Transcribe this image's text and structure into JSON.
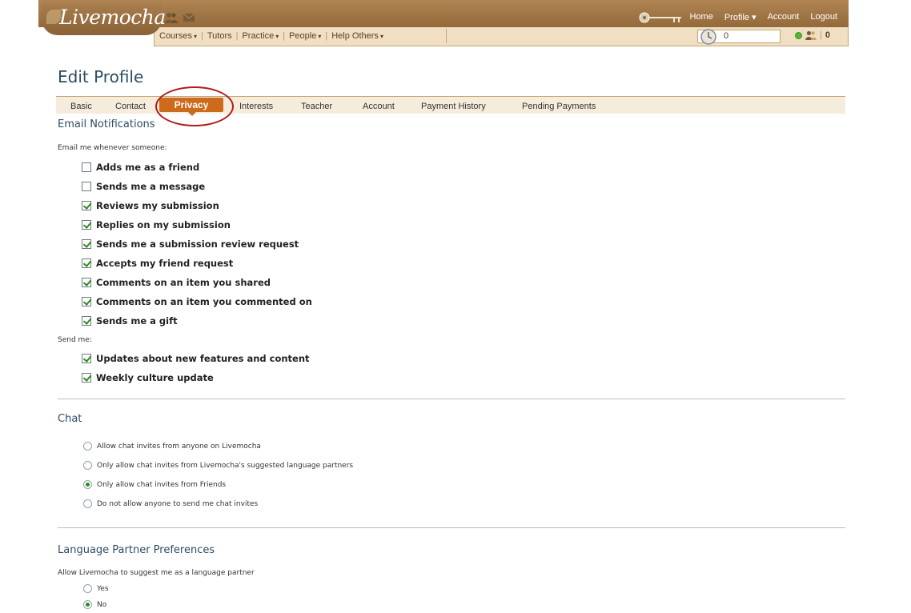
{
  "header": {
    "logo_text": "Livemocha",
    "logo_mark": "·",
    "top_nav": [
      "Home",
      "Profile ▾",
      "Account",
      "Logout"
    ],
    "sub_nav": [
      {
        "label": "Courses",
        "has_menu": true
      },
      {
        "label": "Tutors",
        "has_menu": false
      },
      {
        "label": "Practice",
        "has_menu": true
      },
      {
        "label": "People",
        "has_menu": true
      },
      {
        "label": "Help Others",
        "has_menu": true
      }
    ],
    "caret": "▾",
    "sub_nav_separator": "|",
    "points_value": "0",
    "friends_online_count": "0",
    "count_separator": "|"
  },
  "page": {
    "title": "Edit Profile"
  },
  "tabs": {
    "items": [
      "Basic",
      "Contact",
      "Privacy",
      "Interests",
      "Teacher",
      "Account",
      "Payment History",
      "Pending Payments"
    ],
    "active": "Privacy"
  },
  "email_notifications": {
    "title": "Email Notifications",
    "intro": "Email me whenever someone:",
    "options": [
      {
        "label": "Adds me as a friend",
        "checked": false
      },
      {
        "label": "Sends me a message",
        "checked": false
      },
      {
        "label": "Reviews my submission",
        "checked": true
      },
      {
        "label": "Replies on my submission",
        "checked": true
      },
      {
        "label": "Sends me a submission review request",
        "checked": true
      },
      {
        "label": "Accepts my friend request",
        "checked": true
      },
      {
        "label": "Comments on an item you shared",
        "checked": true
      },
      {
        "label": "Comments on an item you commented on",
        "checked": true
      },
      {
        "label": "Sends me a gift",
        "checked": true
      }
    ],
    "send_me_intro": "Send me:",
    "send_me_options": [
      {
        "label": "Updates about new features and content",
        "checked": true
      },
      {
        "label": "Weekly culture update",
        "checked": true
      }
    ]
  },
  "chat": {
    "title": "Chat",
    "options": [
      {
        "label": "Allow chat invites from anyone on Livemocha",
        "selected": false
      },
      {
        "label": "Only allow chat invites from Livemocha's suggested language partners",
        "selected": false
      },
      {
        "label": "Only allow chat invites from Friends",
        "selected": true
      },
      {
        "label": "Do not allow anyone to send me chat invites",
        "selected": false
      }
    ]
  },
  "language_partner": {
    "title": "Language Partner Preferences",
    "intro": "Allow Livemocha to suggest me as a language partner",
    "options": [
      {
        "label": "Yes",
        "selected": false
      },
      {
        "label": "No",
        "selected": true
      }
    ]
  },
  "colors": {
    "header_brown": "#946a3b",
    "subnav_bg": "#f0dfc3",
    "active_tab": "#cd6a1b",
    "title_blue": "#2d4c63",
    "annotation_red": "#b01c1c",
    "check_green": "#2e8b16"
  }
}
